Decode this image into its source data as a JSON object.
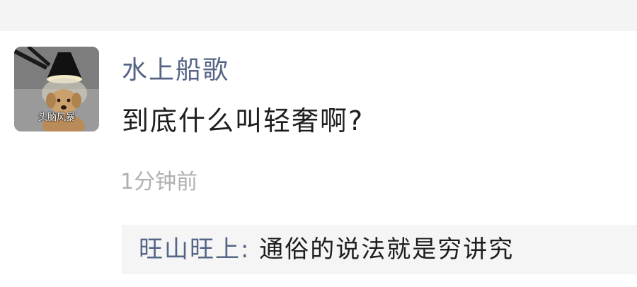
{
  "post": {
    "avatar": {
      "caption": "头脑风暴"
    },
    "nickname": "水上船歌",
    "message": "到底什么叫轻奢啊?",
    "timestamp": "1分钟前"
  },
  "comments": [
    {
      "author": "旺山旺上",
      "separator": ": ",
      "text": "通俗的说法就是穷讲究"
    }
  ],
  "colors": {
    "nickname": "#546585",
    "message": "#1e1e1e",
    "timestamp": "#b0b0b0",
    "comment_bg": "#f5f5f5"
  }
}
